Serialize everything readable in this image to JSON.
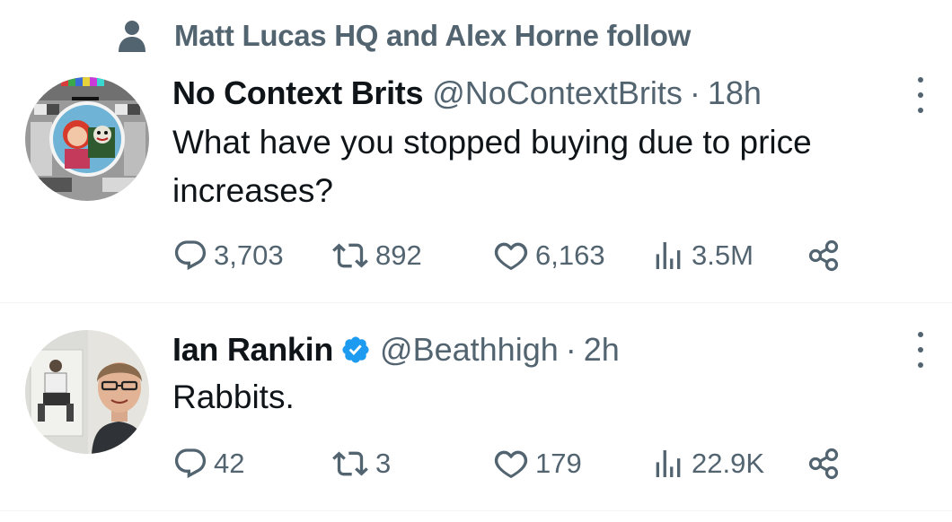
{
  "social_context": {
    "text": "Matt Lucas HQ and Alex Horne follow",
    "icon": "person-icon"
  },
  "tweets": [
    {
      "name": "No Context Brits",
      "handle": "@NoContextBrits",
      "separator": "·",
      "time": "18h",
      "verified": false,
      "text": "What have you stopped buying due to price increases?",
      "replies": "3,703",
      "retweets": "892",
      "likes": "6,163",
      "views": "3.5M"
    },
    {
      "name": "Ian Rankin",
      "handle": "@Beathhigh",
      "separator": "·",
      "time": "2h",
      "verified": true,
      "text": "Rabbits.",
      "replies": "42",
      "retweets": "3",
      "likes": "179",
      "views": "22.9K"
    }
  ],
  "colors": {
    "text_primary": "#0f1419",
    "text_secondary": "#536471",
    "verified_blue": "#1d9bf0",
    "divider": "#eff3f4"
  }
}
